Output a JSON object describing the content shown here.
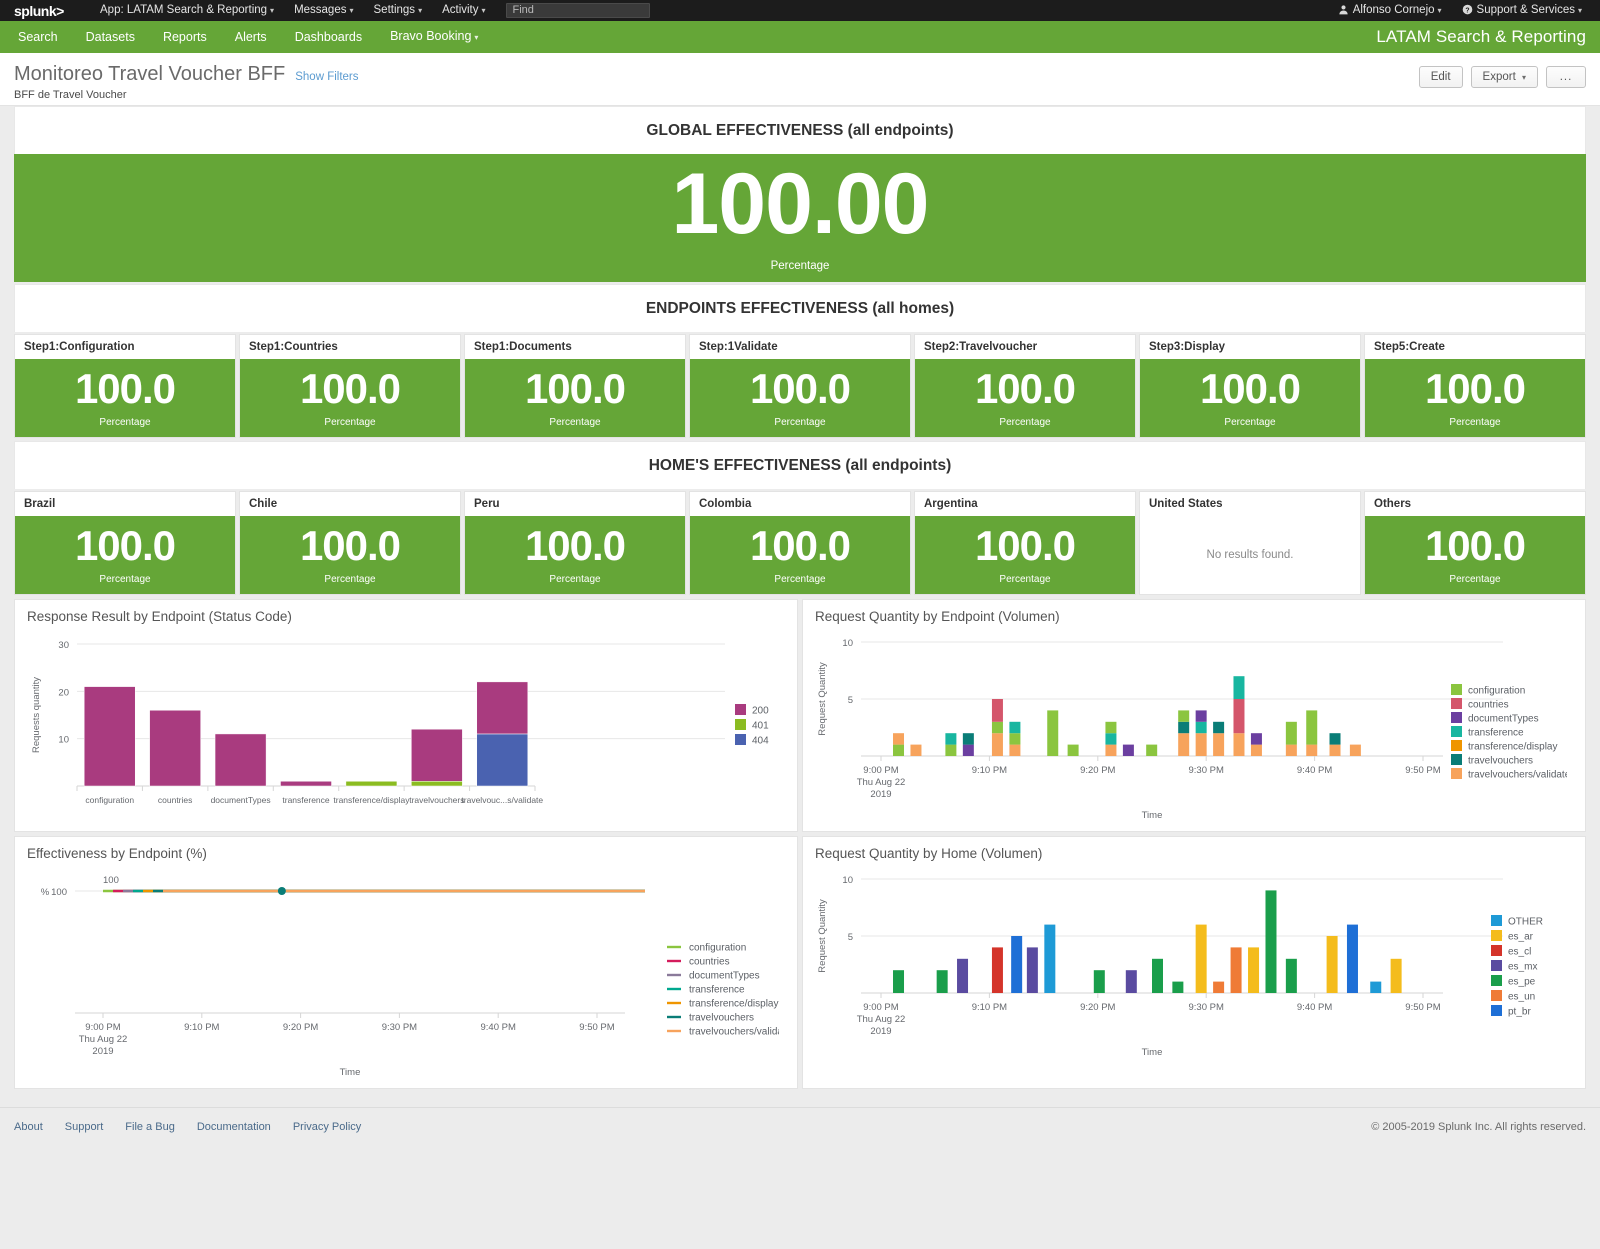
{
  "topbar": {
    "logo_text": "splunk>",
    "app_menu": "App: LATAM Search & Reporting",
    "messages": "Messages",
    "settings": "Settings",
    "activity": "Activity",
    "find_placeholder": "Find",
    "user": "Alfonso Cornejo",
    "support": "Support & Services",
    "user_icon": "user-icon",
    "help_icon": "help-circle-icon",
    "caret": "⌄"
  },
  "appbar": {
    "items": [
      {
        "label": "Search"
      },
      {
        "label": "Datasets"
      },
      {
        "label": "Reports"
      },
      {
        "label": "Alerts"
      },
      {
        "label": "Dashboards"
      },
      {
        "label": "Bravo Booking",
        "has_caret": true
      }
    ],
    "app_name": "LATAM Search & Reporting"
  },
  "header": {
    "title": "Monitoreo Travel Voucher BFF",
    "show_filters": "Show Filters",
    "subtitle": "BFF de Travel Voucher",
    "edit_label": "Edit",
    "export_label": "Export",
    "more_label": "..."
  },
  "colors": {
    "green": "#65a637",
    "splunk_green": "#65a637",
    "magenta": "#a93b7f",
    "olive": "#8bbc21",
    "blue": "#4a62b0"
  },
  "sections": {
    "global": {
      "title": "GLOBAL EFFECTIVENESS (all endpoints)",
      "value": "100.00",
      "label": "Percentage"
    },
    "endpoints": {
      "title": "ENDPOINTS EFFECTIVENESS (all homes)",
      "cards": [
        {
          "title": "Step1:Configuration",
          "value": "100.0",
          "label": "Percentage"
        },
        {
          "title": "Step1:Countries",
          "value": "100.0",
          "label": "Percentage"
        },
        {
          "title": "Step1:Documents",
          "value": "100.0",
          "label": "Percentage"
        },
        {
          "title": "Step:1Validate",
          "value": "100.0",
          "label": "Percentage"
        },
        {
          "title": "Step2:Travelvoucher",
          "value": "100.0",
          "label": "Percentage"
        },
        {
          "title": "Step3:Display",
          "value": "100.0",
          "label": "Percentage"
        },
        {
          "title": "Step5:Create",
          "value": "100.0",
          "label": "Percentage"
        }
      ]
    },
    "homes": {
      "title": "HOME'S EFFECTIVENESS (all endpoints)",
      "cards": [
        {
          "title": "Brazil",
          "value": "100.0",
          "label": "Percentage"
        },
        {
          "title": "Chile",
          "value": "100.0",
          "label": "Percentage"
        },
        {
          "title": "Peru",
          "value": "100.0",
          "label": "Percentage"
        },
        {
          "title": "Colombia",
          "value": "100.0",
          "label": "Percentage"
        },
        {
          "title": "Argentina",
          "value": "100.0",
          "label": "Percentage"
        },
        {
          "title": "United States",
          "value": "",
          "label": "",
          "empty_text": "No results found."
        },
        {
          "title": "Others",
          "value": "100.0",
          "label": "Percentage"
        }
      ]
    }
  },
  "chart_data": [
    {
      "id": "response-result-by-endpoint",
      "type": "bar",
      "stacked": true,
      "title": "Response Result by Endpoint (Status Code)",
      "xlabel": "",
      "ylabel": "Requests quantity",
      "ylim": [
        0,
        30
      ],
      "yticks": [
        10,
        20,
        30
      ],
      "grid": true,
      "legend_position": "right",
      "categories": [
        "configuration",
        "countries",
        "documentTypes",
        "transference",
        "transference/display",
        "travelvouchers",
        "travelvouc...s/validate"
      ],
      "series": [
        {
          "name": "200",
          "color": "#a93b7f",
          "values": [
            21,
            16,
            11,
            1,
            0,
            11,
            11
          ]
        },
        {
          "name": "401",
          "color": "#8bbc21",
          "values": [
            0,
            0,
            0,
            0,
            1,
            1,
            0
          ]
        },
        {
          "name": "404",
          "color": "#4a62b0",
          "values": [
            0,
            0,
            0,
            0,
            0,
            0,
            11
          ]
        }
      ]
    },
    {
      "id": "request-quantity-by-endpoint",
      "type": "bar",
      "stacked": true,
      "title": "Request Quantity by Endpoint (Volumen)",
      "xlabel": "Time",
      "ylabel": "Request Quantity",
      "ylim": [
        0,
        10
      ],
      "yticks": [
        5,
        10
      ],
      "grid": true,
      "legend_position": "right",
      "xtick_labels": [
        "9:00 PM",
        "9:10 PM",
        "9:20 PM",
        "9:30 PM",
        "9:40 PM",
        "9:50 PM"
      ],
      "xtick_sub": [
        "Thu Aug 22",
        "2019"
      ],
      "legend": [
        {
          "name": "configuration",
          "color": "#8bc53f"
        },
        {
          "name": "countries",
          "color": "#d4566b"
        },
        {
          "name": "documentTypes",
          "color": "#6b3fa0"
        },
        {
          "name": "transference",
          "color": "#18b6a0"
        },
        {
          "name": "transference/display",
          "color": "#ef9500"
        },
        {
          "name": "travelvouchers",
          "color": "#0a7d77"
        },
        {
          "name": "travelvouchers/validate",
          "color": "#f7a35c"
        }
      ],
      "bars": [
        {
          "x": 0.055,
          "stack": [
            {
              "c": "#8bc53f",
              "v": 1
            },
            {
              "c": "#f7a35c",
              "v": 1
            }
          ]
        },
        {
          "x": 0.085,
          "stack": [
            {
              "c": "#f7a35c",
              "v": 1
            }
          ]
        },
        {
          "x": 0.145,
          "stack": [
            {
              "c": "#8bc53f",
              "v": 1
            },
            {
              "c": "#18b6a0",
              "v": 1
            }
          ]
        },
        {
          "x": 0.175,
          "stack": [
            {
              "c": "#6b3fa0",
              "v": 1
            },
            {
              "c": "#0a7d77",
              "v": 1
            }
          ]
        },
        {
          "x": 0.225,
          "stack": [
            {
              "c": "#f7a35c",
              "v": 2
            },
            {
              "c": "#8bc53f",
              "v": 1
            },
            {
              "c": "#d4566b",
              "v": 2
            }
          ]
        },
        {
          "x": 0.255,
          "stack": [
            {
              "c": "#f7a35c",
              "v": 1
            },
            {
              "c": "#8bc53f",
              "v": 1
            },
            {
              "c": "#18b6a0",
              "v": 1
            }
          ]
        },
        {
          "x": 0.32,
          "stack": [
            {
              "c": "#8bc53f",
              "v": 4
            }
          ]
        },
        {
          "x": 0.355,
          "stack": [
            {
              "c": "#8bc53f",
              "v": 1
            }
          ]
        },
        {
          "x": 0.42,
          "stack": [
            {
              "c": "#f7a35c",
              "v": 1
            },
            {
              "c": "#18b6a0",
              "v": 1
            },
            {
              "c": "#8bc53f",
              "v": 1
            }
          ]
        },
        {
          "x": 0.45,
          "stack": [
            {
              "c": "#6b3fa0",
              "v": 1
            }
          ]
        },
        {
          "x": 0.49,
          "stack": [
            {
              "c": "#8bc53f",
              "v": 1
            }
          ]
        },
        {
          "x": 0.545,
          "stack": [
            {
              "c": "#f7a35c",
              "v": 2
            },
            {
              "c": "#0a7d77",
              "v": 1
            },
            {
              "c": "#8bc53f",
              "v": 1
            }
          ]
        },
        {
          "x": 0.575,
          "stack": [
            {
              "c": "#f7a35c",
              "v": 2
            },
            {
              "c": "#18b6a0",
              "v": 1
            },
            {
              "c": "#6b3fa0",
              "v": 1
            }
          ]
        },
        {
          "x": 0.605,
          "stack": [
            {
              "c": "#f7a35c",
              "v": 2
            },
            {
              "c": "#0a7d77",
              "v": 1
            }
          ]
        },
        {
          "x": 0.64,
          "stack": [
            {
              "c": "#f7a35c",
              "v": 2
            },
            {
              "c": "#d4566b",
              "v": 3
            },
            {
              "c": "#18b6a0",
              "v": 2
            }
          ]
        },
        {
          "x": 0.67,
          "stack": [
            {
              "c": "#f7a35c",
              "v": 1
            },
            {
              "c": "#6b3fa0",
              "v": 1
            }
          ]
        },
        {
          "x": 0.73,
          "stack": [
            {
              "c": "#f7a35c",
              "v": 1
            },
            {
              "c": "#8bc53f",
              "v": 2
            }
          ]
        },
        {
          "x": 0.765,
          "stack": [
            {
              "c": "#f7a35c",
              "v": 1
            },
            {
              "c": "#8bc53f",
              "v": 3
            }
          ]
        },
        {
          "x": 0.805,
          "stack": [
            {
              "c": "#f7a35c",
              "v": 1
            },
            {
              "c": "#0a7d77",
              "v": 1
            }
          ]
        },
        {
          "x": 0.84,
          "stack": [
            {
              "c": "#f7a35c",
              "v": 1
            }
          ]
        }
      ]
    },
    {
      "id": "effectiveness-by-endpoint",
      "type": "line",
      "title": "Effectiveness by Endpoint (%)",
      "xlabel": "Time",
      "ylabel": "%",
      "ylim": [
        0,
        100
      ],
      "yticks": [
        100
      ],
      "data_label": "100",
      "grid": true,
      "legend_position": "right",
      "xtick_labels": [
        "9:00 PM",
        "9:10 PM",
        "9:20 PM",
        "9:30 PM",
        "9:40 PM",
        "9:50 PM"
      ],
      "xtick_sub": [
        "Thu Aug 22",
        "2019"
      ],
      "series": [
        {
          "name": "configuration",
          "color": "#8bc53f",
          "value": 100
        },
        {
          "name": "countries",
          "color": "#d41c5c",
          "value": 100
        },
        {
          "name": "documentTypes",
          "color": "#8a7a9a",
          "value": 100
        },
        {
          "name": "transference",
          "color": "#00a88f",
          "value": 100
        },
        {
          "name": "transference/display",
          "color": "#ef9500",
          "value": 100
        },
        {
          "name": "travelvouchers",
          "color": "#0a7d77",
          "value": 100
        },
        {
          "name": "travelvouchers/validate",
          "color": "#f7a35c",
          "value": 100
        }
      ],
      "marker": {
        "x": 0.33,
        "color": "#0a7d77"
      }
    },
    {
      "id": "request-quantity-by-home",
      "type": "bar",
      "stacked": true,
      "title": "Request Quantity by Home (Volumen)",
      "xlabel": "Time",
      "ylabel": "Request Quantity",
      "ylim": [
        0,
        10
      ],
      "yticks": [
        5,
        10
      ],
      "grid": true,
      "legend_position": "right",
      "xtick_labels": [
        "9:00 PM",
        "9:10 PM",
        "9:20 PM",
        "9:30 PM",
        "9:40 PM",
        "9:50 PM"
      ],
      "xtick_sub": [
        "Thu Aug 22",
        "2019"
      ],
      "legend": [
        {
          "name": "OTHER",
          "color": "#1e9ad6"
        },
        {
          "name": "es_ar",
          "color": "#f4bc1c"
        },
        {
          "name": "es_cl",
          "color": "#d4342a"
        },
        {
          "name": "es_mx",
          "color": "#5a4ba0"
        },
        {
          "name": "es_pe",
          "color": "#1a9e4b"
        },
        {
          "name": "es_un",
          "color": "#ef7b36"
        },
        {
          "name": "pt_br",
          "color": "#1e6fd6"
        }
      ],
      "bars": [
        {
          "x": 0.055,
          "stack": [
            {
              "c": "#1a9e4b",
              "v": 2
            }
          ]
        },
        {
          "x": 0.13,
          "stack": [
            {
              "c": "#1a9e4b",
              "v": 2
            }
          ]
        },
        {
          "x": 0.165,
          "stack": [
            {
              "c": "#5a4ba0",
              "v": 3
            }
          ]
        },
        {
          "x": 0.225,
          "stack": [
            {
              "c": "#d4342a",
              "v": 4
            }
          ]
        },
        {
          "x": 0.258,
          "stack": [
            {
              "c": "#1e6fd6",
              "v": 5
            }
          ]
        },
        {
          "x": 0.285,
          "stack": [
            {
              "c": "#5a4ba0",
              "v": 4
            }
          ]
        },
        {
          "x": 0.315,
          "stack": [
            {
              "c": "#1e9ad6",
              "v": 6
            }
          ]
        },
        {
          "x": 0.4,
          "stack": [
            {
              "c": "#1a9e4b",
              "v": 2
            }
          ]
        },
        {
          "x": 0.455,
          "stack": [
            {
              "c": "#5a4ba0",
              "v": 2
            }
          ]
        },
        {
          "x": 0.5,
          "stack": [
            {
              "c": "#1a9e4b",
              "v": 3
            }
          ]
        },
        {
          "x": 0.535,
          "stack": [
            {
              "c": "#1a9e4b",
              "v": 1
            }
          ]
        },
        {
          "x": 0.575,
          "stack": [
            {
              "c": "#f4bc1c",
              "v": 6
            }
          ]
        },
        {
          "x": 0.605,
          "stack": [
            {
              "c": "#ef7b36",
              "v": 1
            }
          ]
        },
        {
          "x": 0.635,
          "stack": [
            {
              "c": "#ef7b36",
              "v": 4
            }
          ]
        },
        {
          "x": 0.665,
          "stack": [
            {
              "c": "#f4bc1c",
              "v": 4
            }
          ]
        },
        {
          "x": 0.695,
          "stack": [
            {
              "c": "#1a9e4b",
              "v": 9
            }
          ]
        },
        {
          "x": 0.73,
          "stack": [
            {
              "c": "#1a9e4b",
              "v": 3
            }
          ]
        },
        {
          "x": 0.8,
          "stack": [
            {
              "c": "#f4bc1c",
              "v": 5
            }
          ]
        },
        {
          "x": 0.835,
          "stack": [
            {
              "c": "#1e6fd6",
              "v": 6
            }
          ]
        },
        {
          "x": 0.875,
          "stack": [
            {
              "c": "#1e9ad6",
              "v": 1
            }
          ]
        },
        {
          "x": 0.91,
          "stack": [
            {
              "c": "#f4bc1c",
              "v": 3
            }
          ]
        }
      ]
    }
  ],
  "footer": {
    "links": [
      "About",
      "Support",
      "File a Bug",
      "Documentation",
      "Privacy Policy"
    ],
    "copyright": "© 2005-2019 Splunk Inc. All rights reserved."
  }
}
